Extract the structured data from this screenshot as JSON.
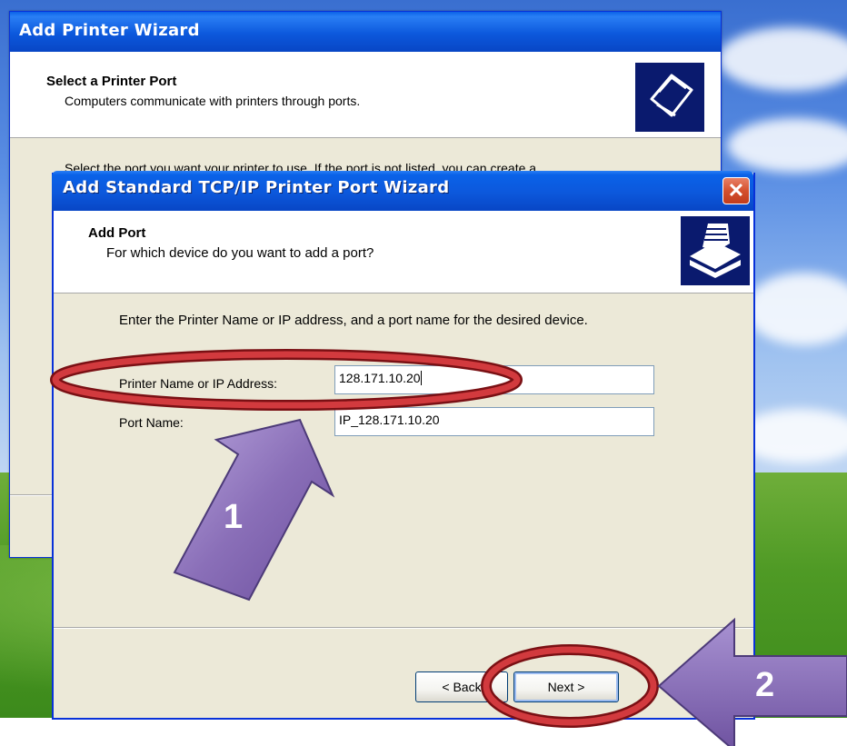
{
  "back_window": {
    "title": "Add Printer Wizard",
    "header_title": "Select a Printer Port",
    "header_subtitle": "Computers communicate with printers through ports.",
    "body_text": "Select the port you want your printer to use.  If the port is not listed, you can create a"
  },
  "front_window": {
    "title": "Add Standard TCP/IP Printer Port Wizard",
    "close_glyph": "✕",
    "header_title": "Add Port",
    "header_subtitle": "For which device do you want to add a port?",
    "instruction": "Enter the Printer Name or IP address, and a port name for the desired device.",
    "printer_name_label": "Printer Name or IP Address:",
    "printer_name_value": "128.171.10.20",
    "port_name_label": "Port Name:",
    "port_name_value": "IP_128.171.10.20",
    "back_button": "< Back",
    "next_button": "Next >"
  },
  "annotations": {
    "step1": "1",
    "step2": "2",
    "highlight_color": "#c0262a",
    "arrow_color": "#8a6fb8"
  },
  "icons": [
    "printer-port-icon",
    "printer-icon",
    "close-icon"
  ]
}
